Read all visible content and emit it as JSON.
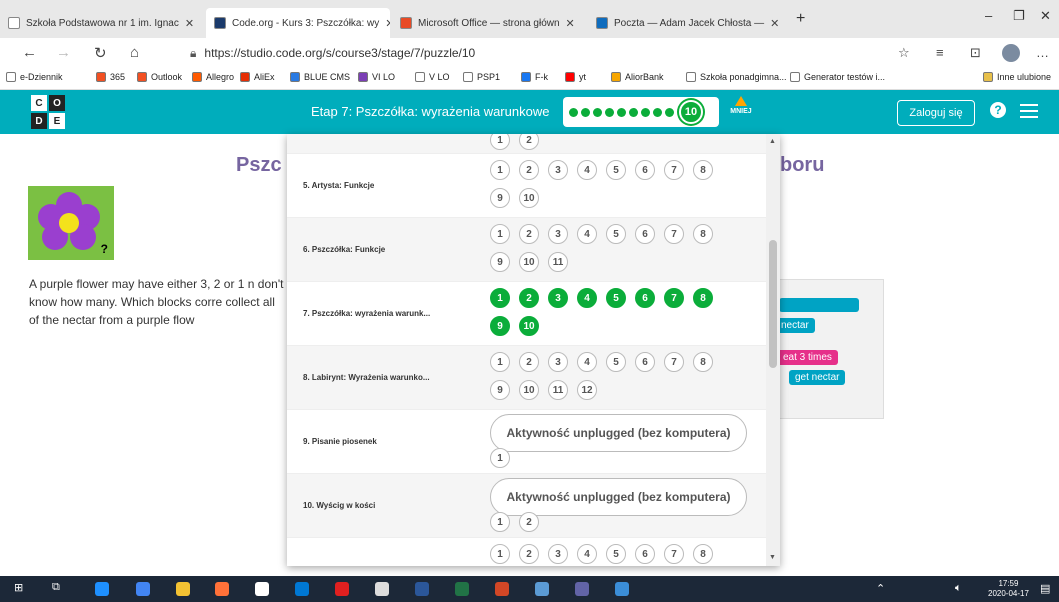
{
  "browser": {
    "tabs": [
      {
        "title": "Szkoła Podstawowa nr 1 im. Ignac",
        "color": "#ffffff",
        "active": false
      },
      {
        "title": "Code.org - Kurs 3: Pszczółka: wy",
        "color": "#1b3a6b",
        "active": true
      },
      {
        "title": "Microsoft Office — strona główn",
        "color": "#e84b26",
        "active": false
      },
      {
        "title": "Poczta — Adam Jacek Chłosta —",
        "color": "#0f6cbd",
        "active": false
      }
    ],
    "url": "https://studio.code.org/s/course3/stage/7/puzzle/10",
    "bookmarks": [
      {
        "label": "e-Dziennik",
        "color": "#ffffff"
      },
      {
        "label": "365",
        "color": "#f25022"
      },
      {
        "label": "Outlook",
        "color": "#f25022"
      },
      {
        "label": "Allegro",
        "color": "#ff5a00"
      },
      {
        "label": "AliEx",
        "color": "#e62e04"
      },
      {
        "label": "BLUE CMS",
        "color": "#2a7ae2"
      },
      {
        "label": "VI LO",
        "color": "#7b3fb5"
      },
      {
        "label": "V LO",
        "color": "#ffffff"
      },
      {
        "label": "PSP1",
        "color": "#ffffff"
      },
      {
        "label": "F-k",
        "color": "#1877f2"
      },
      {
        "label": "yt",
        "color": "#ff0000"
      },
      {
        "label": "AliorBank",
        "color": "#f7a600"
      },
      {
        "label": "Szkoła ponadgimna...",
        "color": "#ffffff"
      },
      {
        "label": "Generator testów i...",
        "color": "#ffffff"
      },
      {
        "label": "Inne ulubione",
        "color": "#e8c04a"
      }
    ]
  },
  "header": {
    "stage_title": "Etap 7: Pszczółka: wyrażenia warunkowe",
    "current_puzzle": "10",
    "less_label": "MNIEJ",
    "signin_label": "Zaloguj się",
    "help_label": "?"
  },
  "page": {
    "title_left": "Pszc",
    "title_right": "boru",
    "description": "A purple flower may have either 3, 2 or 1 n don't know how many. Which blocks corre collect all of the nectar from a purple flow",
    "blocks": [
      "nectar",
      "eat 3 times",
      "get nectar"
    ]
  },
  "dropdown": {
    "rows": [
      {
        "label": "",
        "bubbles": [
          "1",
          "2"
        ],
        "completed": 0,
        "partial_top": true
      },
      {
        "label": "5. Artysta: Funkcje",
        "bubbles": [
          "1",
          "2",
          "3",
          "4",
          "5",
          "6",
          "7",
          "8",
          "9",
          "10"
        ],
        "completed": 0
      },
      {
        "label": "6. Pszczółka: Funkcje",
        "bubbles": [
          "1",
          "2",
          "3",
          "4",
          "5",
          "6",
          "7",
          "8",
          "9",
          "10",
          "11"
        ],
        "completed": 0
      },
      {
        "label": "7. Pszczółka: wyrażenia warunk...",
        "bubbles": [
          "1",
          "2",
          "3",
          "4",
          "5",
          "6",
          "7",
          "8",
          "9",
          "10"
        ],
        "completed": 10
      },
      {
        "label": "8. Labirynt: Wyrażenia warunko...",
        "bubbles": [
          "1",
          "2",
          "3",
          "4",
          "5",
          "6",
          "7",
          "8",
          "9",
          "10",
          "11",
          "12"
        ],
        "completed": 0
      },
      {
        "label": "9. Pisanie piosenek",
        "unplugged": "Aktywność unplugged (bez komputera)",
        "bubbles": [
          "1"
        ],
        "completed": 0
      },
      {
        "label": "10. Wyścig w kości",
        "unplugged": "Aktywność unplugged (bez komputera)",
        "bubbles": [
          "1",
          "2"
        ],
        "completed": 0
      },
      {
        "label": "",
        "bubbles": [
          "1",
          "2",
          "3",
          "4",
          "5",
          "6",
          "7",
          "8"
        ],
        "completed": 0
      }
    ]
  },
  "taskbar": {
    "time": "17:59",
    "date": "2020-04-17"
  }
}
